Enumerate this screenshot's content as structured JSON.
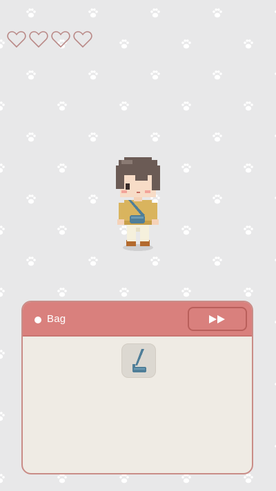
{
  "hud": {
    "hearts_total": 4,
    "hearts_filled": 0,
    "heart_color": "#b98987"
  },
  "character": {
    "hair_color": "#6b5b55",
    "shirt_color": "#d9b45e",
    "pants_color": "#f5f0dc",
    "bag_color": "#4f7e98",
    "shoe_color": "#b36a2d"
  },
  "panel": {
    "title": "Bag",
    "header_color": "#d9807d",
    "body_color": "#efebe4",
    "next_button_icon": "fast-forward-icon",
    "items": [
      {
        "name": "crossbody-bag",
        "icon": "bag-icon"
      }
    ]
  },
  "background": {
    "color": "#e8e8e9",
    "pattern_icon": "paw-print-icon"
  }
}
